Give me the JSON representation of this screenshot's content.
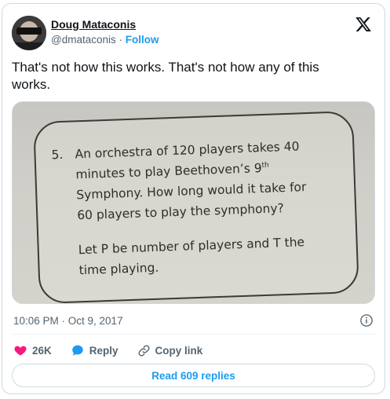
{
  "author": {
    "name": "Doug Mataconis",
    "handle": "@dmataconis",
    "separator": "·",
    "follow_label": "Follow"
  },
  "tweet": {
    "line1": "That's not how this works. That's not how any of this",
    "line2": "works."
  },
  "photo": {
    "problem_number": "5.",
    "lines": [
      "An orchestra of 120 players takes 40",
      "minutes to play Beethoven’s 9",
      "Symphony. How long would it take for",
      "60 players to play the symphony?"
    ],
    "superscript": "th",
    "let_lines": [
      "Let P be number of players and T the",
      "time playing."
    ]
  },
  "meta": {
    "timestamp": "10:06 PM · Oct 9, 2017"
  },
  "actions": {
    "like_count": "26K",
    "reply_label": "Reply",
    "copy_link_label": "Copy link"
  },
  "footer": {
    "read_replies_label": "Read 609 replies"
  },
  "colors": {
    "accent": "#1d9bf0",
    "like": "#f91880",
    "secondary_text": "#536471"
  },
  "icons": [
    "x-logo-icon",
    "heart-icon",
    "reply-bubble-icon",
    "link-icon",
    "info-icon"
  ]
}
